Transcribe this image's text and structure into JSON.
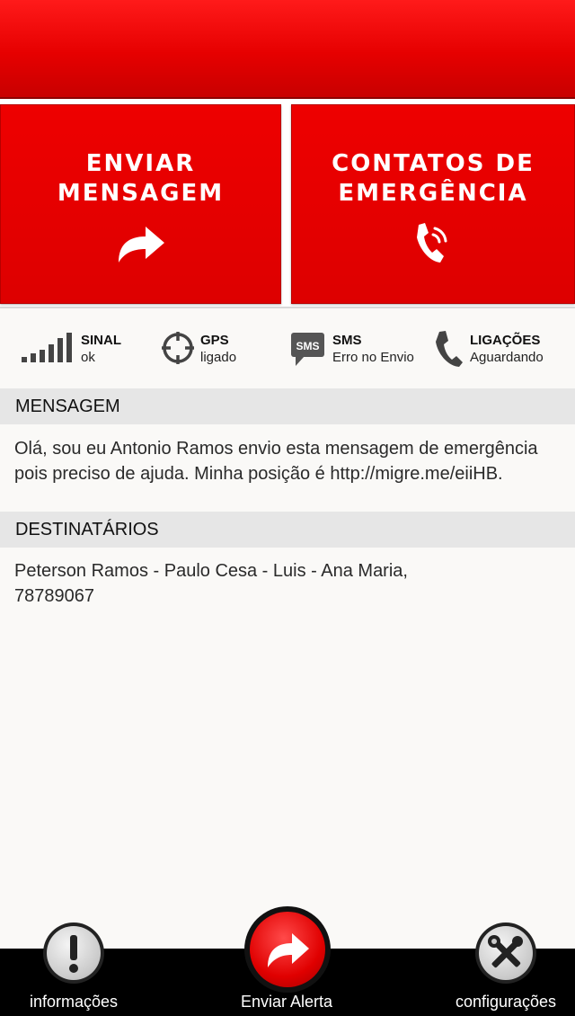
{
  "tiles": {
    "send_message": {
      "title": "ENVIAR\nMENSAGEM",
      "icon": "share-arrow-icon"
    },
    "emergency_contacts": {
      "title": "CONTATOS DE\nEMERGÊNCIA",
      "icon": "phone-ringing-icon"
    }
  },
  "status": {
    "signal": {
      "label": "SINAL",
      "value": "ok",
      "icon": "signal-bars-icon"
    },
    "gps": {
      "label": "GPS",
      "value": "ligado",
      "icon": "crosshair-icon"
    },
    "sms": {
      "label": "SMS",
      "value": "Erro no Envio",
      "icon": "sms-bubble-icon",
      "icon_text": "SMS"
    },
    "calls": {
      "label": "LIGAÇÕES",
      "value": "Aguardando",
      "icon": "phone-icon"
    }
  },
  "message": {
    "header": "MENSAGEM",
    "text": "Olá, sou eu Antonio Ramos envio esta mensagem de emergência pois preciso de ajuda. Minha posição é http://migre.me/eiiHB."
  },
  "recipients": {
    "header": "DESTINATÁRIOS",
    "text": "Peterson Ramos - Paulo Cesa - Luis - Ana Maria, 78789067"
  },
  "bottom_nav": {
    "info": {
      "label": "informações",
      "icon": "exclamation-icon"
    },
    "send_alert": {
      "label": "Enviar Alerta",
      "icon": "share-arrow-icon"
    },
    "settings": {
      "label": "configurações",
      "icon": "tools-icon"
    }
  },
  "colors": {
    "brand_red": "#e60000",
    "dark_red": "#8c0000",
    "header_gray": "#e6e6e6"
  }
}
